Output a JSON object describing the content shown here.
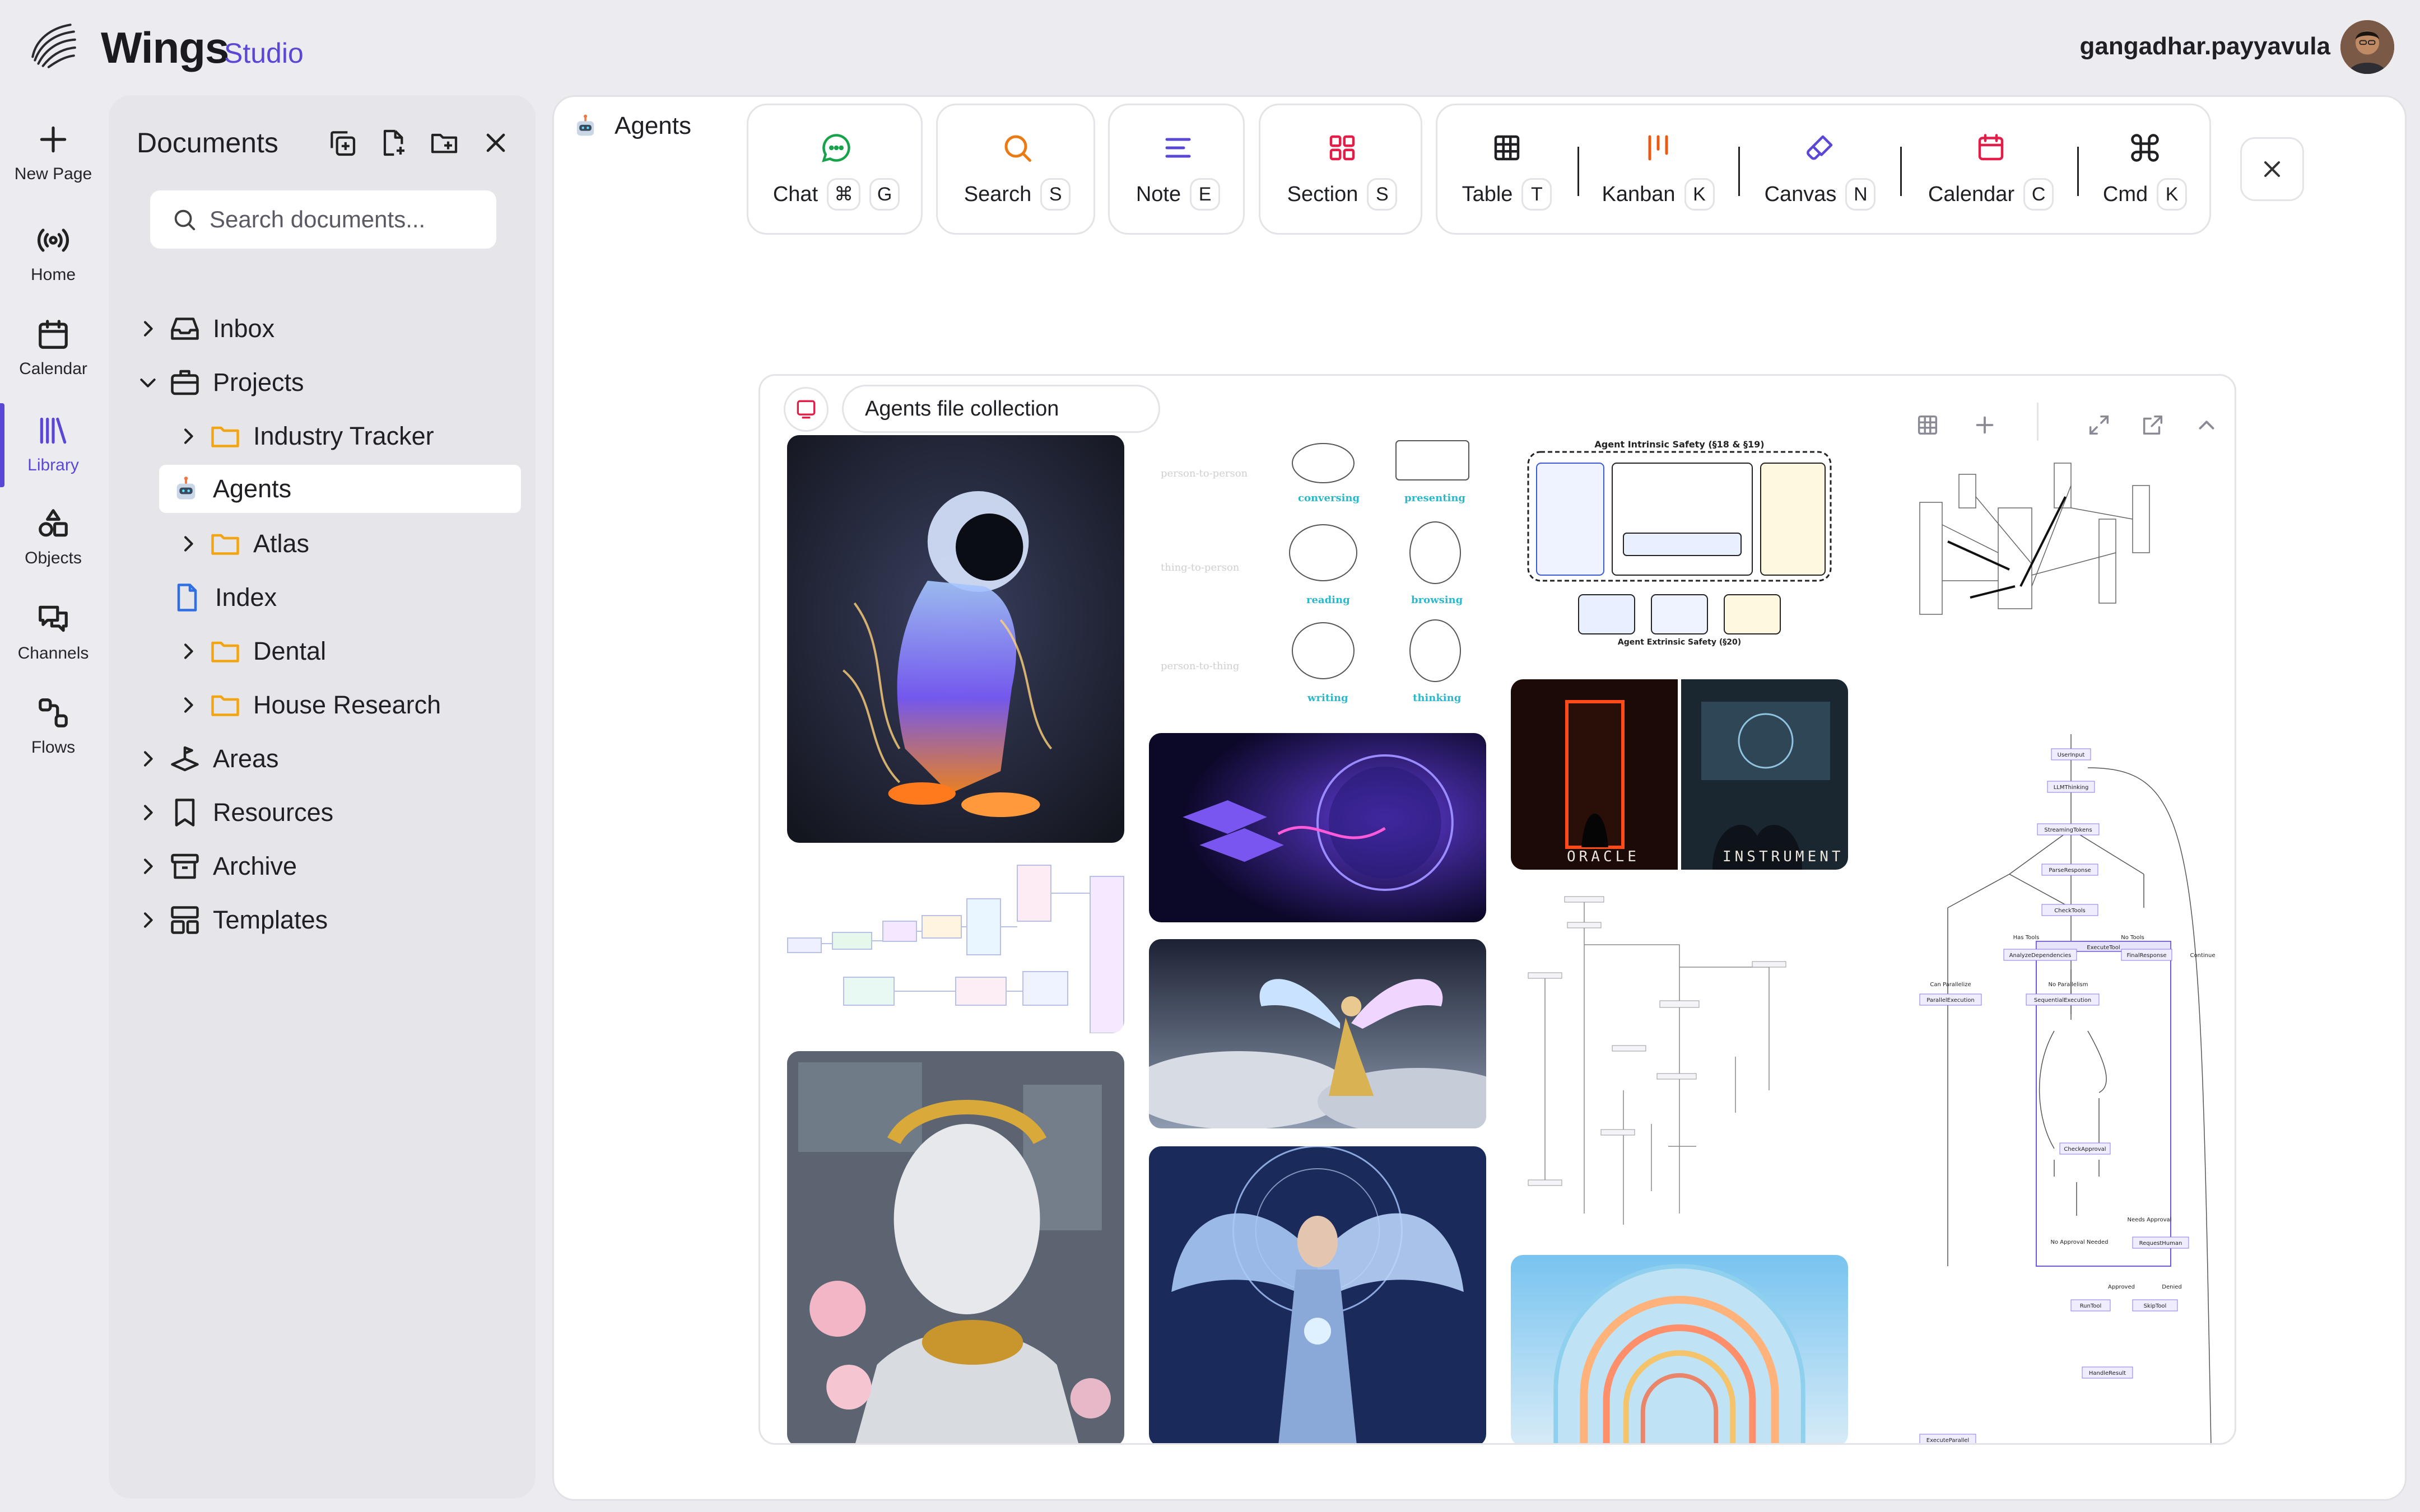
{
  "brand": {
    "name": "Wings",
    "sub": "Studio"
  },
  "user": {
    "name": "gangadhar.payyavula"
  },
  "rail": [
    {
      "label": "New Page",
      "icon": "plus-icon"
    },
    {
      "label": "Home",
      "icon": "broadcast-icon"
    },
    {
      "label": "Calendar",
      "icon": "calendar-icon"
    },
    {
      "label": "Library",
      "icon": "library-icon",
      "active": true
    },
    {
      "label": "Objects",
      "icon": "shapes-icon"
    },
    {
      "label": "Channels",
      "icon": "chat-bubbles-icon"
    },
    {
      "label": "Flows",
      "icon": "flow-icon"
    }
  ],
  "documents": {
    "title": "Documents",
    "search_placeholder": "Search documents...",
    "tree": [
      {
        "label": "Inbox",
        "icon": "inbox-icon",
        "expanded": false
      },
      {
        "label": "Projects",
        "icon": "briefcase-icon",
        "expanded": true
      },
      {
        "label": "Industry Tracker",
        "icon": "folder-icon",
        "expanded": false
      },
      {
        "label": "Agents",
        "icon": "robot-icon",
        "selected": true
      },
      {
        "label": "Atlas",
        "icon": "folder-icon",
        "expanded": false
      },
      {
        "label": "Index",
        "icon": "document-icon"
      },
      {
        "label": "Dental",
        "icon": "folder-icon",
        "expanded": false
      },
      {
        "label": "House Research",
        "icon": "folder-icon",
        "expanded": false
      },
      {
        "label": "Areas",
        "icon": "areas-icon",
        "expanded": false
      },
      {
        "label": "Resources",
        "icon": "bookmark-icon",
        "expanded": false
      },
      {
        "label": "Archive",
        "icon": "archive-icon",
        "expanded": false
      },
      {
        "label": "Templates",
        "icon": "templates-icon",
        "expanded": false
      }
    ]
  },
  "page": {
    "title": "Agents"
  },
  "toolbar": {
    "tools": [
      {
        "label": "Chat",
        "keys": [
          "⌘",
          "G"
        ],
        "color": "#16a34a"
      },
      {
        "label": "Search",
        "keys": [
          "S"
        ],
        "color": "#ea7a13"
      },
      {
        "label": "Note",
        "keys": [
          "E"
        ],
        "color": "#5b47d6"
      },
      {
        "label": "Section",
        "keys": [
          "S"
        ],
        "color": "#e11d48"
      },
      {
        "label": "Table",
        "keys": [
          "T"
        ],
        "color": "#1f1f24"
      },
      {
        "label": "Kanban",
        "keys": [
          "K"
        ],
        "color": "#ea5a13"
      },
      {
        "label": "Canvas",
        "keys": [
          "N"
        ],
        "color": "#5b47d6"
      },
      {
        "label": "Calendar",
        "keys": [
          "C"
        ],
        "color": "#e11d48"
      },
      {
        "label": "Cmd",
        "keys": [
          "K"
        ],
        "color": "#1f1f24"
      }
    ]
  },
  "collection": {
    "title": "Agents file collection",
    "captions": {
      "oracle": "ORACLE",
      "instrument": "INSTRUMENT"
    },
    "sketch_labels": [
      "person-to-person",
      "conversing",
      "presenting",
      "thing-to-person",
      "reading",
      "browsing",
      "person-to-thing",
      "writing",
      "thinking"
    ],
    "safety_title": "Agent Intrinsic Safety (§18 & §19)",
    "safety_footer": "Agent Extrinsic Safety (§20)",
    "flow_nodes": [
      "UserInput",
      "LLMThinking",
      "StreamingTokens",
      "ParseResponse",
      "CheckTools",
      "Has Tools",
      "No Tools",
      "AnalyzeDependencies",
      "FinalResponse",
      "Continue",
      "Can Parallelize",
      "No Parallelism",
      "ParallelExecution",
      "SequentialExecution",
      "ExecuteTool",
      "CheckApproval",
      "Needs Approval",
      "No Approval Needed",
      "RequestHuman",
      "Approved",
      "Denied",
      "RunTool",
      "SkipTool",
      "HandleResult",
      "ExecuteParallel"
    ]
  }
}
